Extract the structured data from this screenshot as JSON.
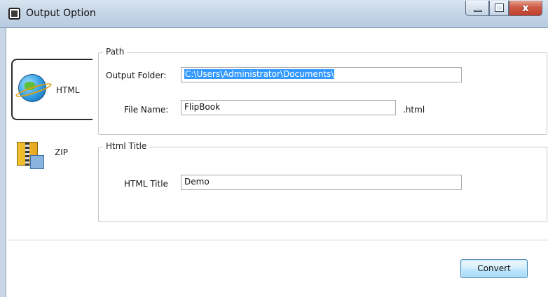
{
  "window": {
    "title": "Output Option",
    "close_glyph": "x",
    "icons": [
      "app-window-icon",
      "minimize-icon",
      "maximize-icon",
      "close-icon"
    ]
  },
  "sidebar": {
    "items": [
      {
        "label": "HTML",
        "icon": "globe-icon",
        "selected": true
      },
      {
        "label": "ZIP",
        "icon": "zip-archive-icon",
        "selected": false
      }
    ]
  },
  "path_group": {
    "legend": "Path",
    "output_folder_label": "Output Folder:",
    "output_folder_value": "C:\\Users\\Administrator\\Documents\\",
    "file_name_label": "File Name:",
    "file_name_value": "FlipBook",
    "file_suffix": ".html"
  },
  "title_group": {
    "legend": "Html Title",
    "html_title_label": "HTML Title",
    "html_title_value": "Demo"
  },
  "actions": {
    "convert_label": "Convert"
  },
  "colors": {
    "selection": "#3399ff",
    "close_button": "#c23f2b",
    "convert_border": "#3c7fb1"
  }
}
